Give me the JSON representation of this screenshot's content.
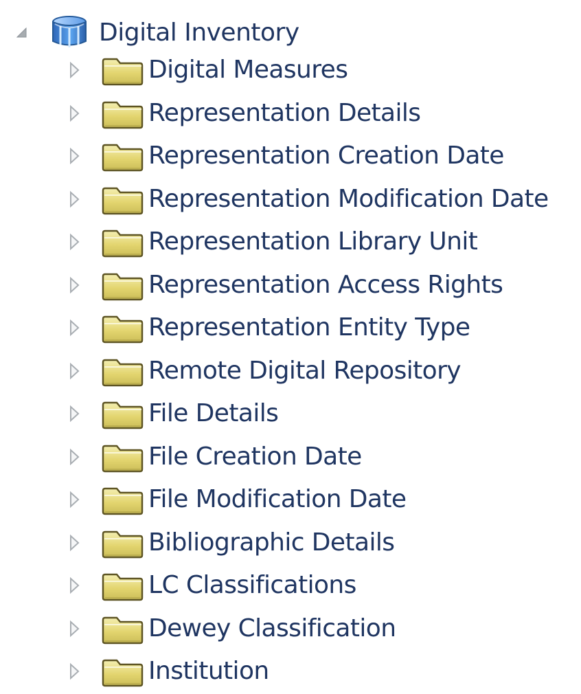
{
  "tree": {
    "root": {
      "label": "Digital Inventory",
      "expanded": true,
      "icon": "subject-area-cube-icon",
      "toggle_icon": "expanded-triangle-icon"
    },
    "children": [
      {
        "label": "Digital Measures",
        "icon": "folder-icon",
        "toggle_icon": "collapsed-triangle-icon"
      },
      {
        "label": "Representation Details",
        "icon": "folder-icon",
        "toggle_icon": "collapsed-triangle-icon"
      },
      {
        "label": "Representation Creation Date",
        "icon": "folder-icon",
        "toggle_icon": "collapsed-triangle-icon"
      },
      {
        "label": "Representation Modification Date",
        "icon": "folder-icon",
        "toggle_icon": "collapsed-triangle-icon"
      },
      {
        "label": "Representation Library Unit",
        "icon": "folder-icon",
        "toggle_icon": "collapsed-triangle-icon"
      },
      {
        "label": "Representation Access Rights",
        "icon": "folder-icon",
        "toggle_icon": "collapsed-triangle-icon"
      },
      {
        "label": "Representation Entity Type",
        "icon": "folder-icon",
        "toggle_icon": "collapsed-triangle-icon"
      },
      {
        "label": "Remote Digital Repository",
        "icon": "folder-icon",
        "toggle_icon": "collapsed-triangle-icon"
      },
      {
        "label": "File Details",
        "icon": "folder-icon",
        "toggle_icon": "collapsed-triangle-icon"
      },
      {
        "label": "File Creation Date",
        "icon": "folder-icon",
        "toggle_icon": "collapsed-triangle-icon"
      },
      {
        "label": "File Modification Date",
        "icon": "folder-icon",
        "toggle_icon": "collapsed-triangle-icon"
      },
      {
        "label": "Bibliographic Details",
        "icon": "folder-icon",
        "toggle_icon": "collapsed-triangle-icon"
      },
      {
        "label": "LC Classifications",
        "icon": "folder-icon",
        "toggle_icon": "collapsed-triangle-icon"
      },
      {
        "label": "Dewey Classification",
        "icon": "folder-icon",
        "toggle_icon": "collapsed-triangle-icon"
      },
      {
        "label": "Institution",
        "icon": "folder-icon",
        "toggle_icon": "collapsed-triangle-icon"
      }
    ]
  },
  "colors": {
    "text": "#1f3561",
    "folder_fill": "#e6d978",
    "folder_stroke": "#5f5524",
    "toggle": "#9ea4aa",
    "cube_blue": "#3d78c6"
  }
}
